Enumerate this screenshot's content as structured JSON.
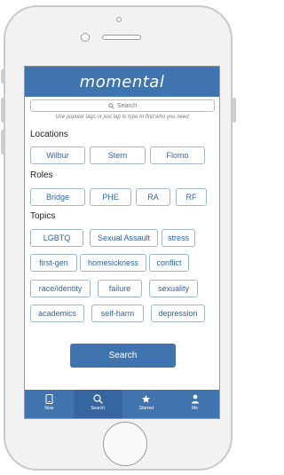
{
  "app": {
    "title": "momental"
  },
  "search": {
    "placeholder": "Search",
    "hint": "Use popular tags or just tap to type to find who you need"
  },
  "sections": {
    "locations": {
      "title": "Locations",
      "items": [
        "Wilbur",
        "Stern",
        "Flomo"
      ]
    },
    "roles": {
      "title": "Roles",
      "items": [
        "Bridge",
        "PHE",
        "RA",
        "RF"
      ]
    },
    "topics": {
      "title": "Topics",
      "items": [
        "LGBTQ",
        "Sexual Assault",
        "stress",
        "first-gen",
        "homesickness",
        "conflict",
        "race/identity",
        "failure",
        "sexuality",
        "academics",
        "self-harm",
        "depression"
      ]
    }
  },
  "search_button": "Search",
  "tabs": [
    {
      "label": "Now",
      "icon": "phone-icon"
    },
    {
      "label": "Search",
      "icon": "search-icon"
    },
    {
      "label": "Starred",
      "icon": "star-icon"
    },
    {
      "label": "Me",
      "icon": "person-icon"
    }
  ],
  "colors": {
    "brand": "#3f74ae",
    "chip_text": "#2f64a5",
    "chip_border": "#9fb6cf"
  }
}
